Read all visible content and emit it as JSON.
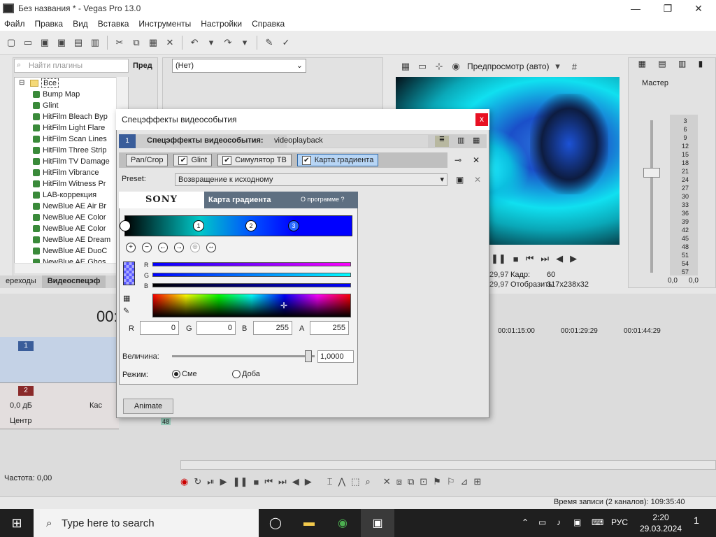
{
  "window": {
    "title": "Без названия * - Vegas Pro 13.0",
    "minimize": "—",
    "restore": "❐",
    "close": "✕"
  },
  "menu": [
    "Файл",
    "Правка",
    "Вид",
    "Вставка",
    "Инструменты",
    "Настройки",
    "Справка"
  ],
  "plugins": {
    "search_placeholder": "Найти плагины",
    "root": "Все",
    "items": [
      "Bump Map",
      "Glint",
      "HitFilm Bleach Byp",
      "HitFilm Light Flare",
      "HitFilm Scan Lines",
      "HitFilm Three Strip",
      "HitFilm TV Damage",
      "HitFilm Vibrance",
      "HitFilm Witness Pr",
      "LAB-коррекция",
      "NewBlue AE Air Br",
      "NewBlue AE Color",
      "NewBlue AE Color",
      "NewBlue AE Dream",
      "NewBlue AE DuoC",
      "NewBlue AE Ghos"
    ],
    "side_label": "Пред",
    "tabs": [
      "ереходы",
      "Видеоспецэф"
    ]
  },
  "fxchain": {
    "selected": "(Нет)"
  },
  "preview": {
    "label": "Предпросмотр (авто)",
    "info": [
      {
        "k": "29,97",
        "label": "Кадр:",
        "value": "60"
      },
      {
        "k": "29,97",
        "label": "Отобразить:",
        "value": "317x238x32"
      }
    ]
  },
  "master": {
    "label": "Мастер",
    "scale": [
      "3",
      "6",
      "9",
      "12",
      "15",
      "18",
      "21",
      "24",
      "27",
      "30",
      "33",
      "36",
      "39",
      "42",
      "45",
      "48",
      "51",
      "54",
      "57"
    ],
    "val_left": "0,0",
    "val_right": "0,0"
  },
  "timeline": {
    "timecode": "00:",
    "ruler": [
      "00:01:15:00",
      "00:01:29:29",
      "00:01:44:29"
    ],
    "track1_num": "1",
    "track2_num": "2",
    "db": "0,0 дБ",
    "pan": "Центр",
    "label_kas": "Кас",
    "rate": "Частота: 0,00",
    "status": "Время записи (2 каналов): 109:35:40",
    "clip_num": "48"
  },
  "dialog": {
    "title": "Спецэффекты видеособытия",
    "close": "x",
    "header_badge": "1",
    "header_title": "Спецэффекты видеособытия:",
    "header_value": "videoplayback",
    "fx_tabs": [
      {
        "label": "Pan/Crop",
        "checkbox": false,
        "active": false
      },
      {
        "label": "Glint",
        "checkbox": true,
        "active": false
      },
      {
        "label": "Симулятор ТВ",
        "checkbox": true,
        "active": false
      },
      {
        "label": "Карта градиента",
        "checkbox": true,
        "active": true
      }
    ],
    "preset_label": "Preset:",
    "preset_value": "Возвращение к исходному",
    "sony_logo": "SONY",
    "plugin_title": "Карта градиента",
    "about": "О программе  ?",
    "gradient_stops": [
      "1",
      "2",
      "3"
    ],
    "channels": [
      "R",
      "G",
      "B"
    ],
    "rgba": [
      {
        "label": "R",
        "value": "0"
      },
      {
        "label": "G",
        "value": "0"
      },
      {
        "label": "B",
        "value": "255"
      },
      {
        "label": "A",
        "value": "255"
      }
    ],
    "magnitude_label": "Величина:",
    "magnitude_value": "1,0000",
    "magnitude_fraction": 0.98,
    "mode_label": "Режим:",
    "mode_options": [
      "Сме",
      "Доба"
    ],
    "animate": "Animate"
  },
  "taskbar": {
    "search_placeholder": "Type here to search",
    "lang": "РУС",
    "time": "2:20",
    "date": "29.03.2024",
    "notifications": "1"
  }
}
